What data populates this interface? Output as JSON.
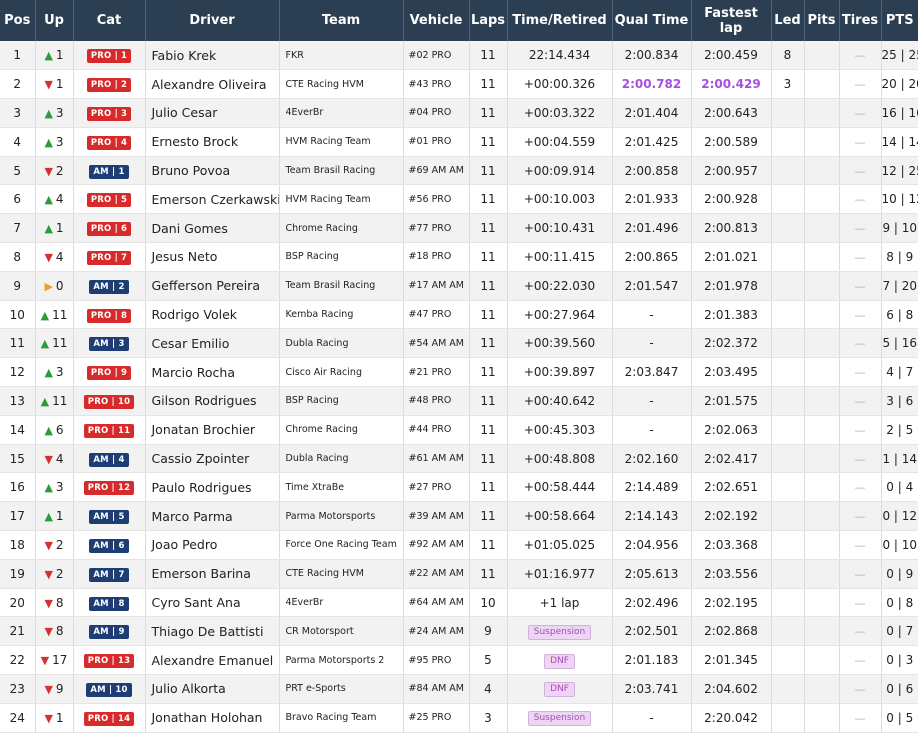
{
  "headers": {
    "pos": "Pos",
    "up": "Up",
    "cat": "Cat",
    "driver": "Driver",
    "team": "Team",
    "vehicle": "Vehicle",
    "laps": "Laps",
    "time": "Time/Retired",
    "qual": "Qual Time",
    "fastest": "Fastest lap",
    "led": "Led",
    "pits": "Pits",
    "tires": "Tires",
    "pts": "PTS"
  },
  "colors": {
    "header_bg": "#2b3e52",
    "pro_badge": "#d72a2a",
    "am_badge": "#1d3d73",
    "best_lap": "#a64fe0",
    "up_arrow": "#2e9a3c",
    "down_arrow": "#d23232",
    "same_arrow": "#f0a020"
  },
  "rows": [
    {
      "pos": "1",
      "dir": "up",
      "change": "1",
      "cat": "PRO | 1",
      "catType": "pro",
      "driver": "Fabio Krek",
      "team": "FKR",
      "vehicle": "#02 PRO",
      "laps": "11",
      "time": "22:14.434",
      "timeBadge": false,
      "qual": "2:00.834",
      "qualBest": false,
      "fast": "2:00.459",
      "fastBest": false,
      "led": "8",
      "pits": "",
      "tires": "—",
      "pts": "25 | 25"
    },
    {
      "pos": "2",
      "dir": "down",
      "change": "1",
      "cat": "PRO | 2",
      "catType": "pro",
      "driver": "Alexandre Oliveira",
      "team": "CTE Racing HVM",
      "vehicle": "#43 PRO",
      "laps": "11",
      "time": "+00:00.326",
      "timeBadge": false,
      "qual": "2:00.782",
      "qualBest": true,
      "fast": "2:00.429",
      "fastBest": true,
      "led": "3",
      "pits": "",
      "tires": "—",
      "pts": "20 | 20"
    },
    {
      "pos": "3",
      "dir": "up",
      "change": "3",
      "cat": "PRO | 3",
      "catType": "pro",
      "driver": "Julio Cesar",
      "team": "4EverBr",
      "vehicle": "#04 PRO",
      "laps": "11",
      "time": "+00:03.322",
      "timeBadge": false,
      "qual": "2:01.404",
      "qualBest": false,
      "fast": "2:00.643",
      "fastBest": false,
      "led": "",
      "pits": "",
      "tires": "—",
      "pts": "16 | 16"
    },
    {
      "pos": "4",
      "dir": "up",
      "change": "3",
      "cat": "PRO | 4",
      "catType": "pro",
      "driver": "Ernesto Brock",
      "team": "HVM Racing Team",
      "vehicle": "#01 PRO",
      "laps": "11",
      "time": "+00:04.559",
      "timeBadge": false,
      "qual": "2:01.425",
      "qualBest": false,
      "fast": "2:00.589",
      "fastBest": false,
      "led": "",
      "pits": "",
      "tires": "—",
      "pts": "14 | 14"
    },
    {
      "pos": "5",
      "dir": "down",
      "change": "2",
      "cat": "AM | 1",
      "catType": "am",
      "driver": "Bruno Povoa",
      "team": "Team Brasil Racing",
      "vehicle": "#69 AM AM",
      "laps": "11",
      "time": "+00:09.914",
      "timeBadge": false,
      "qual": "2:00.858",
      "qualBest": false,
      "fast": "2:00.957",
      "fastBest": false,
      "led": "",
      "pits": "",
      "tires": "—",
      "pts": "12 | 25"
    },
    {
      "pos": "6",
      "dir": "up",
      "change": "4",
      "cat": "PRO | 5",
      "catType": "pro",
      "driver": "Emerson Czerkawski",
      "team": "HVM Racing Team",
      "vehicle": "#56 PRO",
      "laps": "11",
      "time": "+00:10.003",
      "timeBadge": false,
      "qual": "2:01.933",
      "qualBest": false,
      "fast": "2:00.928",
      "fastBest": false,
      "led": "",
      "pits": "",
      "tires": "—",
      "pts": "10 | 12"
    },
    {
      "pos": "7",
      "dir": "up",
      "change": "1",
      "cat": "PRO | 6",
      "catType": "pro",
      "driver": "Dani Gomes",
      "team": "Chrome Racing",
      "vehicle": "#77 PRO",
      "laps": "11",
      "time": "+00:10.431",
      "timeBadge": false,
      "qual": "2:01.496",
      "qualBest": false,
      "fast": "2:00.813",
      "fastBest": false,
      "led": "",
      "pits": "",
      "tires": "—",
      "pts": "9 | 10"
    },
    {
      "pos": "8",
      "dir": "down",
      "change": "4",
      "cat": "PRO | 7",
      "catType": "pro",
      "driver": "Jesus Neto",
      "team": "BSP Racing",
      "vehicle": "#18 PRO",
      "laps": "11",
      "time": "+00:11.415",
      "timeBadge": false,
      "qual": "2:00.865",
      "qualBest": false,
      "fast": "2:01.021",
      "fastBest": false,
      "led": "",
      "pits": "",
      "tires": "—",
      "pts": "8 | 9"
    },
    {
      "pos": "9",
      "dir": "same",
      "change": "0",
      "cat": "AM | 2",
      "catType": "am",
      "driver": "Gefferson Pereira",
      "team": "Team Brasil Racing",
      "vehicle": "#17 AM AM",
      "laps": "11",
      "time": "+00:22.030",
      "timeBadge": false,
      "qual": "2:01.547",
      "qualBest": false,
      "fast": "2:01.978",
      "fastBest": false,
      "led": "",
      "pits": "",
      "tires": "—",
      "pts": "7 | 20"
    },
    {
      "pos": "10",
      "dir": "up",
      "change": "11",
      "cat": "PRO | 8",
      "catType": "pro",
      "driver": "Rodrigo Volek",
      "team": "Kemba Racing",
      "vehicle": "#47 PRO",
      "laps": "11",
      "time": "+00:27.964",
      "timeBadge": false,
      "qual": "-",
      "qualBest": false,
      "fast": "2:01.383",
      "fastBest": false,
      "led": "",
      "pits": "",
      "tires": "—",
      "pts": "6 | 8"
    },
    {
      "pos": "11",
      "dir": "up",
      "change": "11",
      "cat": "AM | 3",
      "catType": "am",
      "driver": "Cesar Emilio",
      "team": "Dubla Racing",
      "vehicle": "#54 AM AM",
      "laps": "11",
      "time": "+00:39.560",
      "timeBadge": false,
      "qual": "-",
      "qualBest": false,
      "fast": "2:02.372",
      "fastBest": false,
      "led": "",
      "pits": "",
      "tires": "—",
      "pts": "5 | 16"
    },
    {
      "pos": "12",
      "dir": "up",
      "change": "3",
      "cat": "PRO | 9",
      "catType": "pro",
      "driver": "Marcio Rocha",
      "team": "Cisco Air Racing",
      "vehicle": "#21 PRO",
      "laps": "11",
      "time": "+00:39.897",
      "timeBadge": false,
      "qual": "2:03.847",
      "qualBest": false,
      "fast": "2:03.495",
      "fastBest": false,
      "led": "",
      "pits": "",
      "tires": "—",
      "pts": "4 | 7"
    },
    {
      "pos": "13",
      "dir": "up",
      "change": "11",
      "cat": "PRO | 10",
      "catType": "pro",
      "driver": "Gilson Rodrigues",
      "team": "BSP Racing",
      "vehicle": "#48 PRO",
      "laps": "11",
      "time": "+00:40.642",
      "timeBadge": false,
      "qual": "-",
      "qualBest": false,
      "fast": "2:01.575",
      "fastBest": false,
      "led": "",
      "pits": "",
      "tires": "—",
      "pts": "3 | 6"
    },
    {
      "pos": "14",
      "dir": "up",
      "change": "6",
      "cat": "PRO | 11",
      "catType": "pro",
      "driver": "Jonatan Brochier",
      "team": "Chrome Racing",
      "vehicle": "#44 PRO",
      "laps": "11",
      "time": "+00:45.303",
      "timeBadge": false,
      "qual": "-",
      "qualBest": false,
      "fast": "2:02.063",
      "fastBest": false,
      "led": "",
      "pits": "",
      "tires": "—",
      "pts": "2 | 5"
    },
    {
      "pos": "15",
      "dir": "down",
      "change": "4",
      "cat": "AM | 4",
      "catType": "am",
      "driver": "Cassio Zpointer",
      "team": "Dubla Racing",
      "vehicle": "#61 AM AM",
      "laps": "11",
      "time": "+00:48.808",
      "timeBadge": false,
      "qual": "2:02.160",
      "qualBest": false,
      "fast": "2:02.417",
      "fastBest": false,
      "led": "",
      "pits": "",
      "tires": "—",
      "pts": "1 | 14"
    },
    {
      "pos": "16",
      "dir": "up",
      "change": "3",
      "cat": "PRO | 12",
      "catType": "pro",
      "driver": "Paulo Rodrigues",
      "team": "Time XtraBe",
      "vehicle": "#27 PRO",
      "laps": "11",
      "time": "+00:58.444",
      "timeBadge": false,
      "qual": "2:14.489",
      "qualBest": false,
      "fast": "2:02.651",
      "fastBest": false,
      "led": "",
      "pits": "",
      "tires": "—",
      "pts": "0 | 4"
    },
    {
      "pos": "17",
      "dir": "up",
      "change": "1",
      "cat": "AM | 5",
      "catType": "am",
      "driver": "Marco Parma",
      "team": "Parma Motorsports",
      "vehicle": "#39 AM AM",
      "laps": "11",
      "time": "+00:58.664",
      "timeBadge": false,
      "qual": "2:14.143",
      "qualBest": false,
      "fast": "2:02.192",
      "fastBest": false,
      "led": "",
      "pits": "",
      "tires": "—",
      "pts": "0 | 12"
    },
    {
      "pos": "18",
      "dir": "down",
      "change": "2",
      "cat": "AM | 6",
      "catType": "am",
      "driver": "Joao Pedro",
      "team": "Force One Racing Team",
      "vehicle": "#92 AM AM",
      "laps": "11",
      "time": "+01:05.025",
      "timeBadge": false,
      "qual": "2:04.956",
      "qualBest": false,
      "fast": "2:03.368",
      "fastBest": false,
      "led": "",
      "pits": "",
      "tires": "—",
      "pts": "0 | 10"
    },
    {
      "pos": "19",
      "dir": "down",
      "change": "2",
      "cat": "AM | 7",
      "catType": "am",
      "driver": "Emerson Barina",
      "team": "CTE Racing HVM",
      "vehicle": "#22 AM AM",
      "laps": "11",
      "time": "+01:16.977",
      "timeBadge": false,
      "qual": "2:05.613",
      "qualBest": false,
      "fast": "2:03.556",
      "fastBest": false,
      "led": "",
      "pits": "",
      "tires": "—",
      "pts": "0 | 9"
    },
    {
      "pos": "20",
      "dir": "down",
      "change": "8",
      "cat": "AM | 8",
      "catType": "am",
      "driver": "Cyro Sant Ana",
      "team": "4EverBr",
      "vehicle": "#64 AM AM",
      "laps": "10",
      "time": "+1 lap",
      "timeBadge": false,
      "qual": "2:02.496",
      "qualBest": false,
      "fast": "2:02.195",
      "fastBest": false,
      "led": "",
      "pits": "",
      "tires": "—",
      "pts": "0 | 8"
    },
    {
      "pos": "21",
      "dir": "down",
      "change": "8",
      "cat": "AM | 9",
      "catType": "am",
      "driver": "Thiago De Battisti",
      "team": "CR Motorsport",
      "vehicle": "#24 AM AM",
      "laps": "9",
      "time": "Suspension",
      "timeBadge": true,
      "qual": "2:02.501",
      "qualBest": false,
      "fast": "2:02.868",
      "fastBest": false,
      "led": "",
      "pits": "",
      "tires": "—",
      "pts": "0 | 7"
    },
    {
      "pos": "22",
      "dir": "down",
      "change": "17",
      "cat": "PRO | 13",
      "catType": "pro",
      "driver": "Alexandre Emanuel",
      "team": "Parma Motorsports 2",
      "vehicle": "#95 PRO",
      "laps": "5",
      "time": "DNF",
      "timeBadge": true,
      "qual": "2:01.183",
      "qualBest": false,
      "fast": "2:01.345",
      "fastBest": false,
      "led": "",
      "pits": "",
      "tires": "—",
      "pts": "0 | 3"
    },
    {
      "pos": "23",
      "dir": "down",
      "change": "9",
      "cat": "AM | 10",
      "catType": "am",
      "driver": "Julio Alkorta",
      "team": "PRT e-Sports",
      "vehicle": "#84 AM AM",
      "laps": "4",
      "time": "DNF",
      "timeBadge": true,
      "qual": "2:03.741",
      "qualBest": false,
      "fast": "2:04.602",
      "fastBest": false,
      "led": "",
      "pits": "",
      "tires": "—",
      "pts": "0 | 6"
    },
    {
      "pos": "24",
      "dir": "down",
      "change": "1",
      "cat": "PRO | 14",
      "catType": "pro",
      "driver": "Jonathan Holohan",
      "team": "Bravo Racing Team",
      "vehicle": "#25 PRO",
      "laps": "3",
      "time": "Suspension",
      "timeBadge": true,
      "qual": "-",
      "qualBest": false,
      "fast": "2:20.042",
      "fastBest": false,
      "led": "",
      "pits": "",
      "tires": "—",
      "pts": "0 | 5"
    }
  ]
}
